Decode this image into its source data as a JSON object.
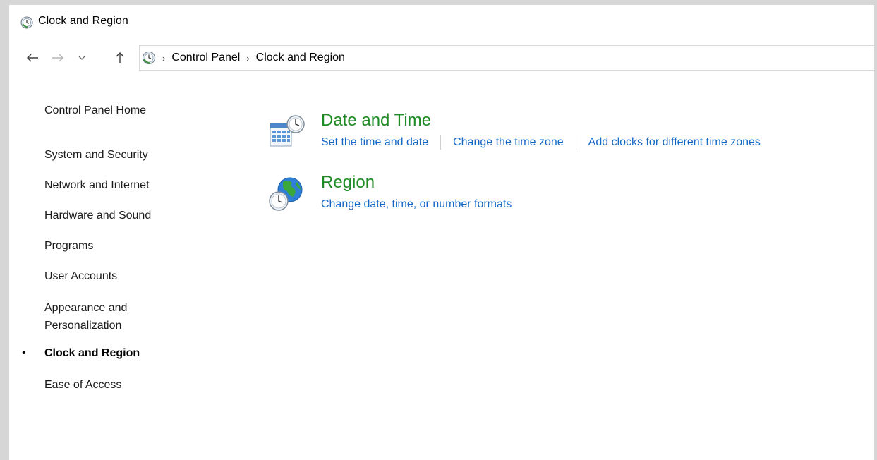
{
  "window": {
    "title": "Clock and Region"
  },
  "nav": {
    "back_icon": "back-arrow-icon",
    "forward_icon": "forward-arrow-icon",
    "recent_icon": "chevron-down-icon",
    "up_icon": "up-arrow-icon"
  },
  "address": {
    "separator": "›",
    "crumbs": [
      "Control Panel",
      "Clock and Region"
    ]
  },
  "sidebar": {
    "home": "Control Panel Home",
    "items": [
      {
        "label": "System and Security"
      },
      {
        "label": "Network and Internet"
      },
      {
        "label": "Hardware and Sound"
      },
      {
        "label": "Programs"
      },
      {
        "label": "User Accounts"
      },
      {
        "label_line1": "Appearance and",
        "label_line2": "Personalization"
      },
      {
        "label": "Clock and Region",
        "current": true
      },
      {
        "label": "Ease of Access"
      }
    ],
    "bullet": "•"
  },
  "main": {
    "categories": [
      {
        "title": "Date and Time",
        "icon": "date-time-icon",
        "links": [
          "Set the time and date",
          "Change the time zone",
          "Add clocks for different time zones"
        ]
      },
      {
        "title": "Region",
        "icon": "region-globe-icon",
        "links": [
          "Change date, time, or number formats"
        ]
      }
    ]
  },
  "colors": {
    "category_title": "#1e8c25",
    "link": "#1567c4",
    "background": "#ffffff",
    "frame": "#d6d6d6"
  }
}
